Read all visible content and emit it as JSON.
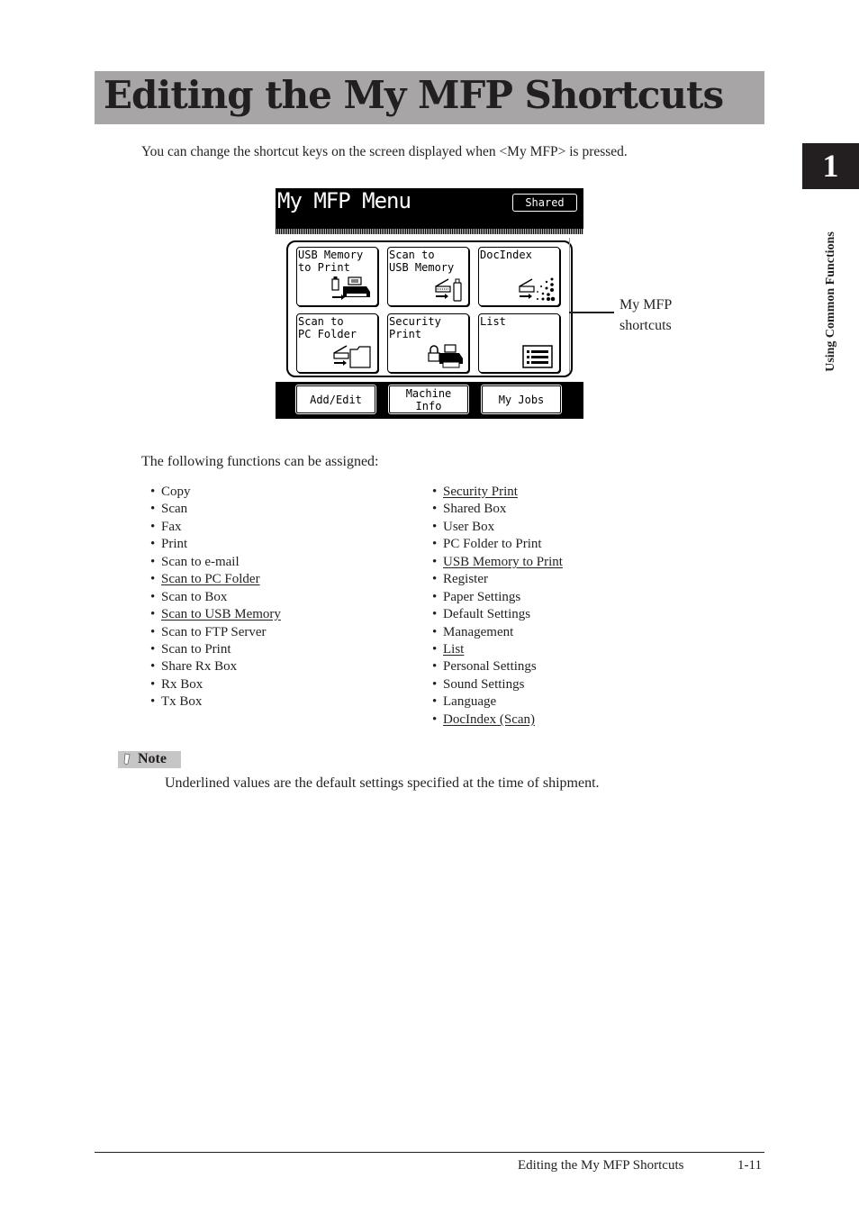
{
  "page": {
    "title": "Editing the My MFP Shortcuts",
    "intro": "You can change the shortcut keys on the screen displayed when <My MFP> is pressed.",
    "chapter_number": "1",
    "chapter_label": "Using Common Functions"
  },
  "mfp_screen": {
    "title": "My MFP Menu",
    "shared_button": "Shared",
    "shortcuts": [
      {
        "label": "USB Memory\nto Print",
        "icon": "usb-to-printer-icon"
      },
      {
        "label": "Scan to\nUSB Memory",
        "icon": "scanner-to-usb-icon"
      },
      {
        "label": "DocIndex",
        "icon": "scanner-to-dots-icon"
      },
      {
        "label": "Scan to\nPC Folder",
        "icon": "scanner-to-folder-icon"
      },
      {
        "label": "Security\nPrint",
        "icon": "lock-printer-icon"
      },
      {
        "label": "List",
        "icon": "list-icon"
      }
    ],
    "bottom_buttons": [
      {
        "label": "Add/Edit"
      },
      {
        "label": "Machine\nInfo"
      },
      {
        "label": "My Jobs"
      }
    ],
    "callout": "My MFP\nshortcuts"
  },
  "assignable": {
    "heading": "The following functions can be assigned:",
    "left": [
      {
        "text": "Copy",
        "default": false
      },
      {
        "text": "Scan",
        "default": false
      },
      {
        "text": "Fax",
        "default": false
      },
      {
        "text": "Print",
        "default": false
      },
      {
        "text": "Scan to e-mail",
        "default": false
      },
      {
        "text": "Scan to PC Folder",
        "default": true
      },
      {
        "text": "Scan to Box",
        "default": false
      },
      {
        "text": "Scan to USB Memory",
        "default": true
      },
      {
        "text": "Scan to FTP Server",
        "default": false
      },
      {
        "text": "Scan to Print",
        "default": false
      },
      {
        "text": "Share Rx Box",
        "default": false
      },
      {
        "text": "Rx Box",
        "default": false
      },
      {
        "text": "Tx Box",
        "default": false
      }
    ],
    "right": [
      {
        "text": "Security Print",
        "default": true
      },
      {
        "text": "Shared Box",
        "default": false
      },
      {
        "text": "User Box",
        "default": false
      },
      {
        "text": "PC Folder to Print",
        "default": false
      },
      {
        "text": "USB Memory to Print",
        "default": true
      },
      {
        "text": "Register",
        "default": false
      },
      {
        "text": "Paper Settings",
        "default": false
      },
      {
        "text": "Default Settings",
        "default": false
      },
      {
        "text": "Management",
        "default": false
      },
      {
        "text": "List",
        "default": true
      },
      {
        "text": "Personal Settings",
        "default": false
      },
      {
        "text": "Sound Settings",
        "default": false
      },
      {
        "text": "Language",
        "default": false
      },
      {
        "text": "DocIndex (Scan)",
        "default": true
      }
    ]
  },
  "note": {
    "label": "Note",
    "text": "Underlined values are the default settings specified at the time of shipment."
  },
  "footer": {
    "title": "Editing the My MFP Shortcuts",
    "page": "1-11"
  }
}
